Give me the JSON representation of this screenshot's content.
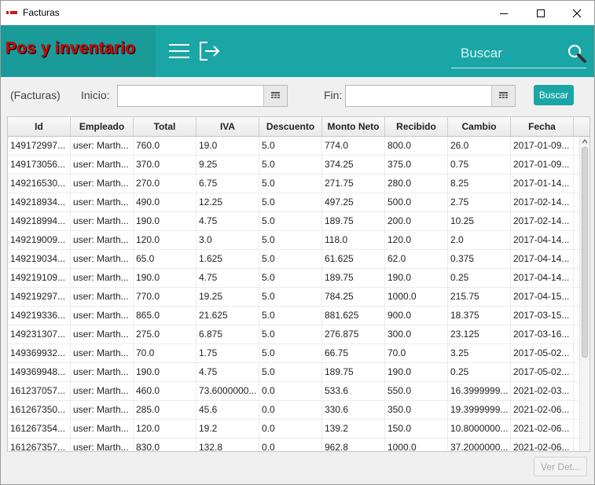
{
  "window": {
    "title": "Facturas"
  },
  "header": {
    "brand": "Pos y inventario",
    "search_placeholder": "Buscar"
  },
  "filters": {
    "section_label": "(Facturas)",
    "start_label": "Inicio:",
    "end_label": "Fin:",
    "search_button": "Buscar"
  },
  "table": {
    "columns": [
      "Id",
      "Empleado",
      "Total",
      "IVA",
      "Descuento",
      "Monto Neto",
      "Recibido",
      "Cambio",
      "Fecha"
    ],
    "rows": [
      [
        "149172997...",
        "user: Marth...",
        "760.0",
        "19.0",
        "5.0",
        "774.0",
        "800.0",
        "26.0",
        "2017-01-09..."
      ],
      [
        "149173056...",
        "user: Marth...",
        "370.0",
        "9.25",
        "5.0",
        "374.25",
        "375.0",
        "0.75",
        "2017-01-09..."
      ],
      [
        "149216530...",
        "user: Marth...",
        "270.0",
        "6.75",
        "5.0",
        "271.75",
        "280.0",
        "8.25",
        "2017-01-14..."
      ],
      [
        "149218934...",
        "user: Marth...",
        "490.0",
        "12.25",
        "5.0",
        "497.25",
        "500.0",
        "2.75",
        "2017-02-14..."
      ],
      [
        "149218994...",
        "user: Marth...",
        "190.0",
        "4.75",
        "5.0",
        "189.75",
        "200.0",
        "10.25",
        "2017-02-14..."
      ],
      [
        "149219009...",
        "user: Marth...",
        "120.0",
        "3.0",
        "5.0",
        "118.0",
        "120.0",
        "2.0",
        "2017-04-14..."
      ],
      [
        "149219034...",
        "user: Marth...",
        "65.0",
        "1.625",
        "5.0",
        "61.625",
        "62.0",
        "0.375",
        "2017-04-14..."
      ],
      [
        "149219109...",
        "user: Marth...",
        "190.0",
        "4.75",
        "5.0",
        "189.75",
        "190.0",
        "0.25",
        "2017-04-14..."
      ],
      [
        "149219297...",
        "user: Marth...",
        "770.0",
        "19.25",
        "5.0",
        "784.25",
        "1000.0",
        "215.75",
        "2017-04-15..."
      ],
      [
        "149219336...",
        "user: Marth...",
        "865.0",
        "21.625",
        "5.0",
        "881.625",
        "900.0",
        "18.375",
        "2017-03-15..."
      ],
      [
        "149231307...",
        "user: Marth...",
        "275.0",
        "6.875",
        "5.0",
        "276.875",
        "300.0",
        "23.125",
        "2017-03-16..."
      ],
      [
        "149369932...",
        "user: Marth...",
        "70.0",
        "1.75",
        "5.0",
        "66.75",
        "70.0",
        "3.25",
        "2017-05-02..."
      ],
      [
        "149369948...",
        "user: Marth...",
        "190.0",
        "4.75",
        "5.0",
        "189.75",
        "190.0",
        "0.25",
        "2017-05-02..."
      ],
      [
        "161237057...",
        "user: Marth...",
        "460.0",
        "73.6000000...",
        "0.0",
        "533.6",
        "550.0",
        "16.3999999...",
        "2021-02-03..."
      ],
      [
        "161267350...",
        "user: Marth...",
        "285.0",
        "45.6",
        "0.0",
        "330.6",
        "350.0",
        "19.3999999...",
        "2021-02-06..."
      ],
      [
        "161267354...",
        "user: Marth...",
        "120.0",
        "19.2",
        "0.0",
        "139.2",
        "150.0",
        "10.8000000...",
        "2021-02-06..."
      ],
      [
        "161267357...",
        "user: Marth...",
        "830.0",
        "132.8",
        "0.0",
        "962.8",
        "1000.0",
        "37.2000000...",
        "2021-02-06..."
      ]
    ]
  },
  "footer": {
    "detail_button": "Ver Det..."
  },
  "colors": {
    "header": "#1ba6a6",
    "brand_bg": "#1b9a9a",
    "brand_text": "#d60000"
  }
}
